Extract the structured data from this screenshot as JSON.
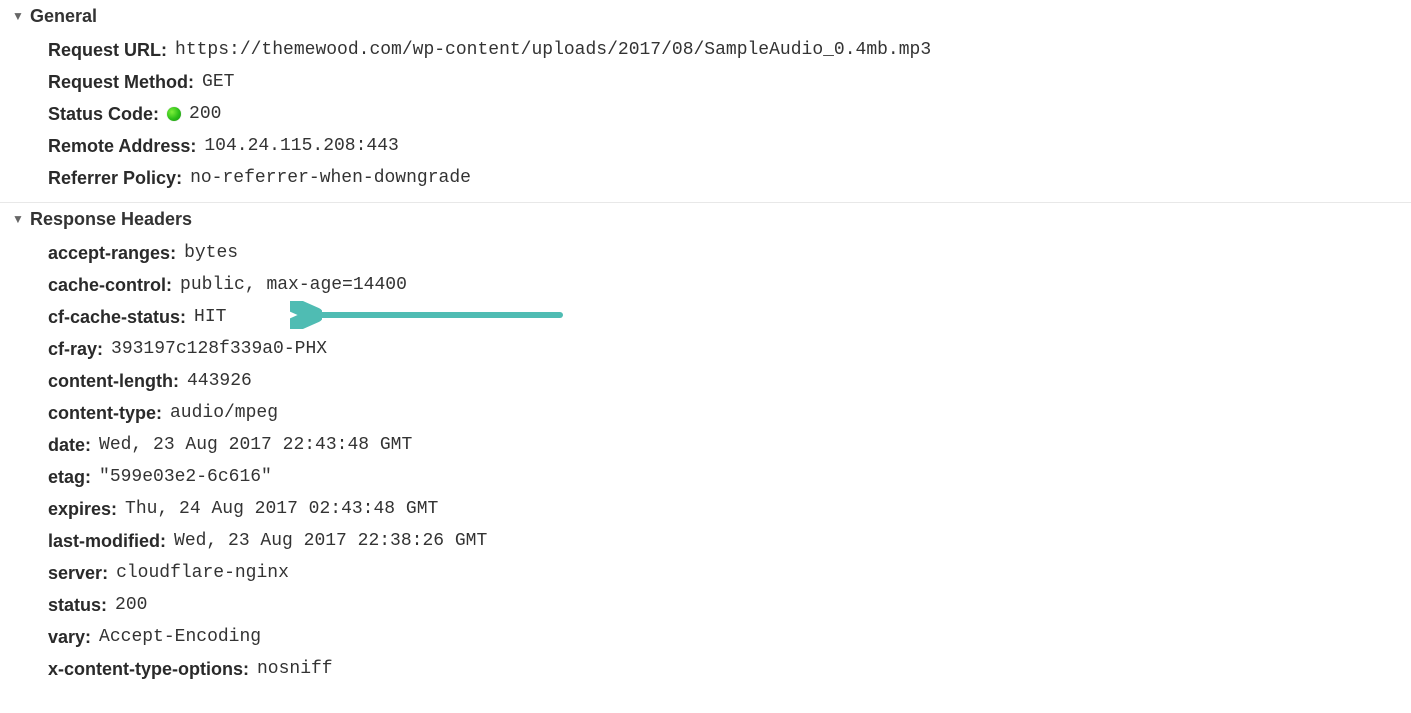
{
  "general": {
    "title": "General",
    "items": [
      {
        "key": "Request URL",
        "value": "https://themewood.com/wp-content/uploads/2017/08/SampleAudio_0.4mb.mp3"
      },
      {
        "key": "Request Method",
        "value": "GET"
      },
      {
        "key": "Status Code",
        "value": "200",
        "status_dot": true
      },
      {
        "key": "Remote Address",
        "value": "104.24.115.208:443"
      },
      {
        "key": "Referrer Policy",
        "value": "no-referrer-when-downgrade"
      }
    ]
  },
  "response_headers": {
    "title": "Response Headers",
    "items": [
      {
        "key": "accept-ranges",
        "value": "bytes"
      },
      {
        "key": "cache-control",
        "value": "public, max-age=14400"
      },
      {
        "key": "cf-cache-status",
        "value": "HIT",
        "highlight_arrow": true
      },
      {
        "key": "cf-ray",
        "value": "393197c128f339a0-PHX"
      },
      {
        "key": "content-length",
        "value": "443926"
      },
      {
        "key": "content-type",
        "value": "audio/mpeg"
      },
      {
        "key": "date",
        "value": "Wed, 23 Aug 2017 22:43:48 GMT"
      },
      {
        "key": "etag",
        "value": "\"599e03e2-6c616\""
      },
      {
        "key": "expires",
        "value": "Thu, 24 Aug 2017 02:43:48 GMT"
      },
      {
        "key": "last-modified",
        "value": "Wed, 23 Aug 2017 22:38:26 GMT"
      },
      {
        "key": "server",
        "value": "cloudflare-nginx"
      },
      {
        "key": "status",
        "value": "200"
      },
      {
        "key": "vary",
        "value": "Accept-Encoding"
      },
      {
        "key": "x-content-type-options",
        "value": "nosniff"
      }
    ]
  },
  "annotation": {
    "arrow_color": "#4fbcb3"
  }
}
